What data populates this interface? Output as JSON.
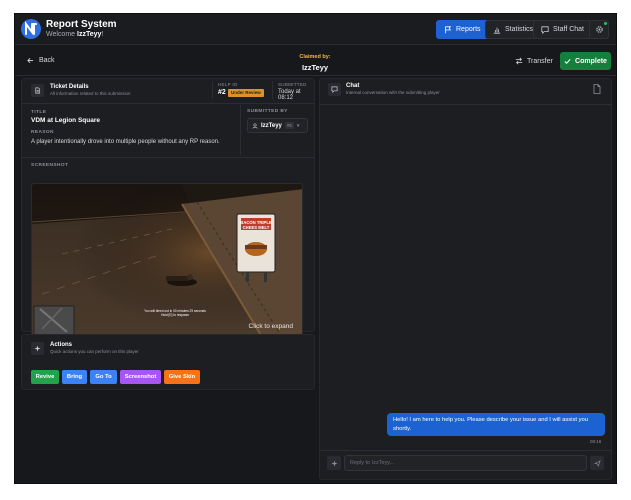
{
  "header": {
    "title": "Report System",
    "welcome_prefix": "Welcome ",
    "username": "IzzTeyy",
    "welcome_suffix": "!",
    "nav": [
      {
        "label": "Reports",
        "icon": "flag-icon",
        "active": true
      },
      {
        "label": "Statistics",
        "icon": "bar-chart-icon",
        "active": false
      },
      {
        "label": "Staff Chat",
        "icon": "chat-icon",
        "active": false
      }
    ]
  },
  "subheader": {
    "back_label": "Back",
    "claimed_label": "Claimed by:",
    "claimed_name": "IzzTeyy",
    "transfer_label": "Transfer",
    "complete_label": "Complete"
  },
  "ticket": {
    "title": "Ticket Details",
    "subtitle": "All information related to this submission",
    "help_id_label": "HELP ID",
    "help_id": "#2",
    "status": "Under Review",
    "submitted_label": "SUBMITTED",
    "submitted_value": "Today at 08:12",
    "title_label": "TITLE",
    "title_value": "VDM at Legion Square",
    "reason_label": "REASON",
    "reason_value": "A player intentionally drove into multiple people without any RP reason.",
    "submitted_by_label": "SUBMITTED BY",
    "submitter_name": "IzzTeyy",
    "submitter_id": "#5",
    "screenshot_label": "SCREENSHOT",
    "expand_hint": "Click to expand",
    "ingame_sign": [
      "BACON TRIPLE",
      "CHEES MELT"
    ],
    "ingame_message": [
      "You will bleed out in 00 minutes 29 seconds",
      "Hold [E] to respawn"
    ]
  },
  "actions": {
    "title": "Actions",
    "subtitle": "Quick actions you can perform on this player",
    "buttons": [
      {
        "label": "Revive",
        "color": "#22a34a"
      },
      {
        "label": "Bring",
        "color": "#3b82f6"
      },
      {
        "label": "Go To",
        "color": "#3b82f6"
      },
      {
        "label": "Screenshot",
        "color": "#a855f7"
      },
      {
        "label": "Give Skin",
        "color": "#f97316"
      }
    ]
  },
  "chat": {
    "title": "Chat",
    "subtitle": "Internal conversation with the submitting player",
    "messages": [
      {
        "text": "Hello! I am here to help you. Please describe your issue and I will assist you shortly.",
        "time": "08:16"
      }
    ],
    "input_placeholder": "Reply to IzzTeyy..."
  },
  "colors": {
    "accent": "#1d62d3",
    "complete": "#15803d",
    "status_badge": "#d9932a",
    "claimed_label": "#f5b942"
  }
}
